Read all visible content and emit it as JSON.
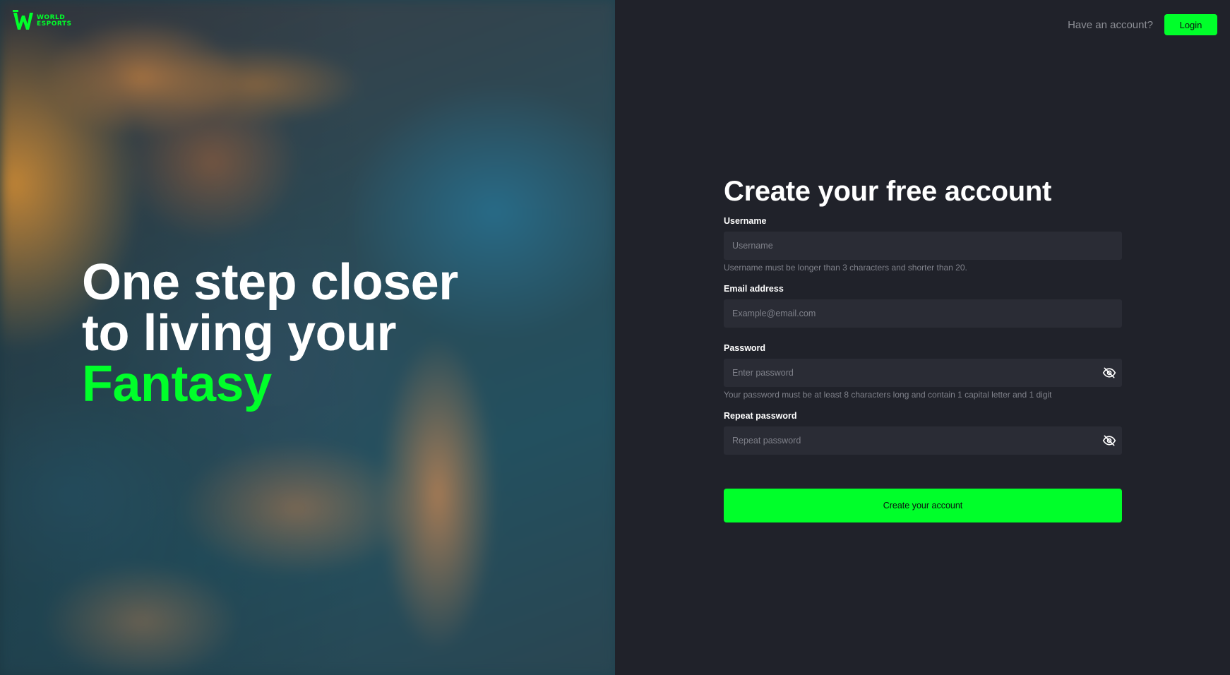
{
  "brand": {
    "logo_name": "w-logo-icon",
    "logo_text_top": "WORLD",
    "logo_text_bottom": "ESPORTS",
    "accent_color": "#00ff2a"
  },
  "hero": {
    "line1": "One step closer",
    "line2": "to living your",
    "accent_word": "Fantasy"
  },
  "header": {
    "have_account": "Have an account?",
    "login_label": "Login"
  },
  "form": {
    "title": "Create your free account",
    "username": {
      "label": "Username",
      "placeholder": "Username",
      "value": "",
      "help": "Username must be longer than 3 characters and shorter than 20."
    },
    "email": {
      "label": "Email address",
      "placeholder": "Example@email.com",
      "value": ""
    },
    "password": {
      "label": "Password",
      "placeholder": "Enter password",
      "value": "",
      "help": "Your password must be at least 8 characters long and contain 1 capital letter and 1 digit",
      "toggle_icon": "eye-off-icon"
    },
    "repeat_password": {
      "label": "Repeat password",
      "placeholder": "Repeat password",
      "value": "",
      "toggle_icon": "eye-off-icon"
    },
    "submit_label": "Create your account"
  }
}
